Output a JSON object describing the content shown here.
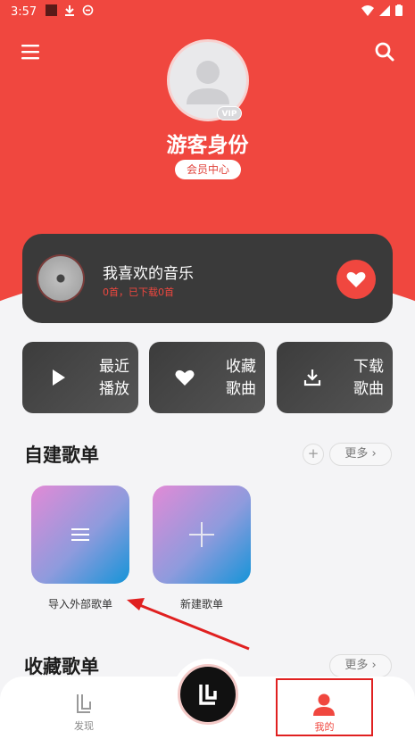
{
  "status_bar": {
    "time": "3:57"
  },
  "header": {
    "nickname": "游客身份",
    "vip_badge": "VIP",
    "member_center": "会员中心"
  },
  "favorites": {
    "title": "我喜欢的音乐",
    "subtitle": "0首，已下载0首"
  },
  "quick_actions": [
    {
      "label": "最近播放",
      "icon": "play-icon"
    },
    {
      "label": "收藏歌曲",
      "icon": "heart-icon"
    },
    {
      "label": "下载歌曲",
      "icon": "download-icon"
    }
  ],
  "created_playlists": {
    "title": "自建歌单",
    "plus": "+",
    "more": "更多 ›",
    "items": [
      {
        "label": "导入外部歌单",
        "icon": "list-icon"
      },
      {
        "label": "新建歌单",
        "icon": "plus-icon"
      }
    ]
  },
  "collected_playlists": {
    "title": "收藏歌单",
    "more": "更多 ›"
  },
  "bottom_nav": {
    "discover": "发现",
    "mine": "我的"
  },
  "colors": {
    "brand_red": "#f0473f",
    "annotation_red": "#e02020"
  }
}
